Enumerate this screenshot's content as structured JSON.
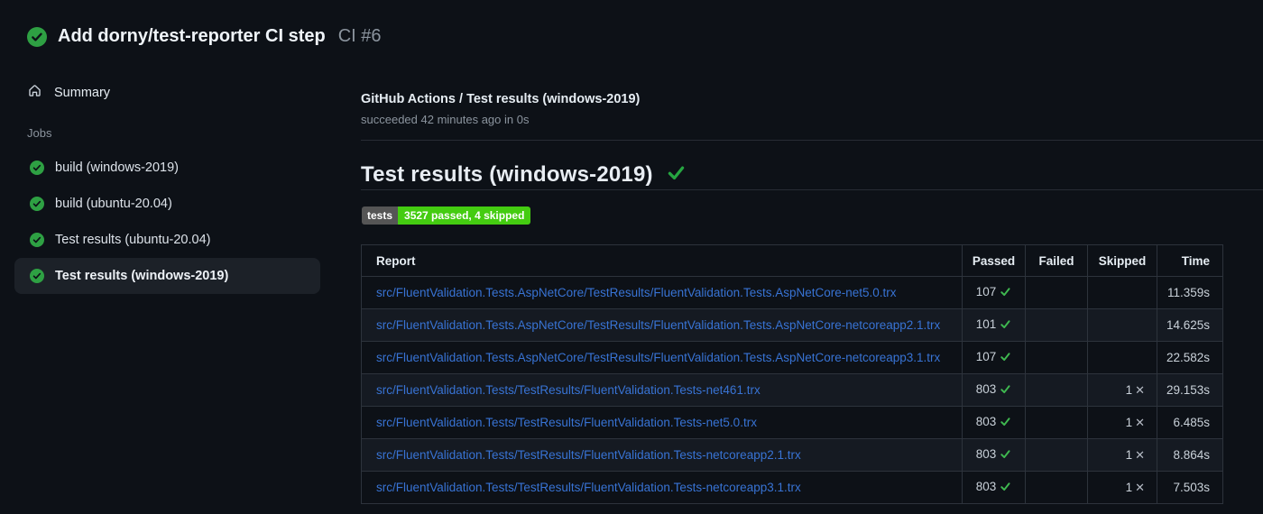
{
  "header": {
    "title": "Add dorny/test-reporter CI step",
    "run_label": "CI #6",
    "status": "success"
  },
  "sidebar": {
    "summary_label": "Summary",
    "jobs_label": "Jobs",
    "jobs": [
      {
        "label": "build (windows-2019)",
        "status": "success",
        "selected": false
      },
      {
        "label": "build (ubuntu-20.04)",
        "status": "success",
        "selected": false
      },
      {
        "label": "Test results (ubuntu-20.04)",
        "status": "success",
        "selected": false
      },
      {
        "label": "Test results (windows-2019)",
        "status": "success",
        "selected": true
      }
    ]
  },
  "main": {
    "check_title": "GitHub Actions / Test results (windows-2019)",
    "check_status": "succeeded 42 minutes ago in 0s",
    "section_title": "Test results (windows-2019)",
    "section_status": "success",
    "badge": {
      "label": "tests",
      "value": "3527 passed, 4 skipped",
      "label_bg": "#555555",
      "value_bg": "#44cc11"
    },
    "table": {
      "columns": [
        "Report",
        "Passed",
        "Failed",
        "Skipped",
        "Time"
      ],
      "rows": [
        {
          "report": "src/FluentValidation.Tests.AspNetCore/TestResults/FluentValidation.Tests.AspNetCore-net5.0.trx",
          "passed": "107",
          "failed": "",
          "skipped": "",
          "time": "11.359s"
        },
        {
          "report": "src/FluentValidation.Tests.AspNetCore/TestResults/FluentValidation.Tests.AspNetCore-netcoreapp2.1.trx",
          "passed": "101",
          "failed": "",
          "skipped": "",
          "time": "14.625s"
        },
        {
          "report": "src/FluentValidation.Tests.AspNetCore/TestResults/FluentValidation.Tests.AspNetCore-netcoreapp3.1.trx",
          "passed": "107",
          "failed": "",
          "skipped": "",
          "time": "22.582s"
        },
        {
          "report": "src/FluentValidation.Tests/TestResults/FluentValidation.Tests-net461.trx",
          "passed": "803",
          "failed": "",
          "skipped": "1",
          "time": "29.153s"
        },
        {
          "report": "src/FluentValidation.Tests/TestResults/FluentValidation.Tests-net5.0.trx",
          "passed": "803",
          "failed": "",
          "skipped": "1",
          "time": "6.485s"
        },
        {
          "report": "src/FluentValidation.Tests/TestResults/FluentValidation.Tests-netcoreapp2.1.trx",
          "passed": "803",
          "failed": "",
          "skipped": "1",
          "time": "8.864s"
        },
        {
          "report": "src/FluentValidation.Tests/TestResults/FluentValidation.Tests-netcoreapp3.1.trx",
          "passed": "803",
          "failed": "",
          "skipped": "1",
          "time": "7.503s"
        }
      ]
    }
  },
  "colors": {
    "background": "#0d1117",
    "success_circle": "#2ea043",
    "check_green": "#3fb950",
    "heading_check_green": "#26a641",
    "link_blue": "#3873d4",
    "muted_text": "#8b949e",
    "table_border": "#2d333c",
    "selected_job_bg": "#1c2128",
    "badge_gray": "#555555",
    "badge_green": "#44cc11"
  }
}
